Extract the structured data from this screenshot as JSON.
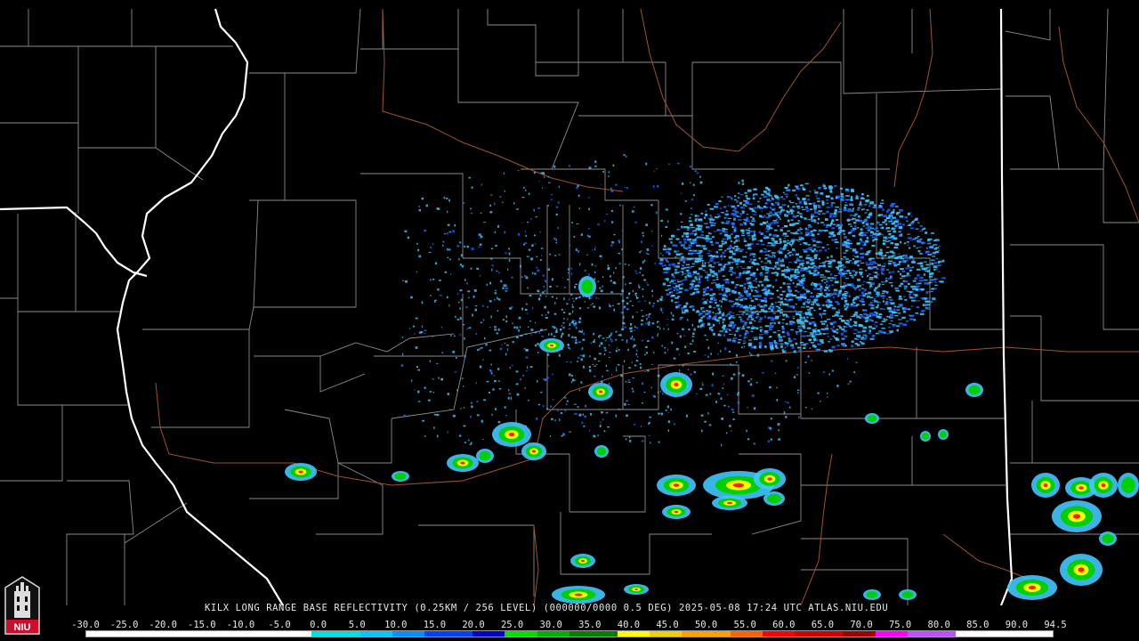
{
  "radar": {
    "caption": "KILX LONG RANGE BASE REFLECTIVITY (0.25KM / 256 LEVEL) (000000/0000 0.5 DEG) 2025-05-08 17:24 UTC  ATLAS.NIU.EDU",
    "logo_text": "NIU",
    "scale_labels": [
      "-30.0",
      "-25.0",
      "-20.0",
      "-15.0",
      "-10.0",
      "-5.0",
      "0.0",
      "5.0",
      "10.0",
      "15.0",
      "20.0",
      "25.0",
      "30.0",
      "35.0",
      "40.0",
      "45.0",
      "50.0",
      "55.0",
      "60.0",
      "65.0",
      "70.0",
      "75.0",
      "80.0",
      "85.0",
      "90.0",
      "94.5"
    ],
    "scale_colors": [
      "#ffffff",
      "#ffffff",
      "#ffffff",
      "#ffffff",
      "#ffffff",
      "#ffffff",
      "#00e5e5",
      "#00b0ff",
      "#0050ff",
      "#0000c8",
      "#00ff00",
      "#00c000",
      "#008a00",
      "#ffff00",
      "#e8c000",
      "#ff9000",
      "#ff0000",
      "#d00000",
      "#b00000",
      "#ff00ff",
      "#9955c9",
      "#ffffff",
      "#ffffff",
      "#ffffff",
      "#ffffff"
    ],
    "colors": {
      "county": "#8c8c8c",
      "state": "#ffffff",
      "river": "#a0522d",
      "echo_light": "#40c8ff",
      "echo_medium": "#1e64ff",
      "echo_green": "#00d000",
      "echo_yellow": "#ffff00",
      "echo_red": "#ff2000"
    }
  }
}
